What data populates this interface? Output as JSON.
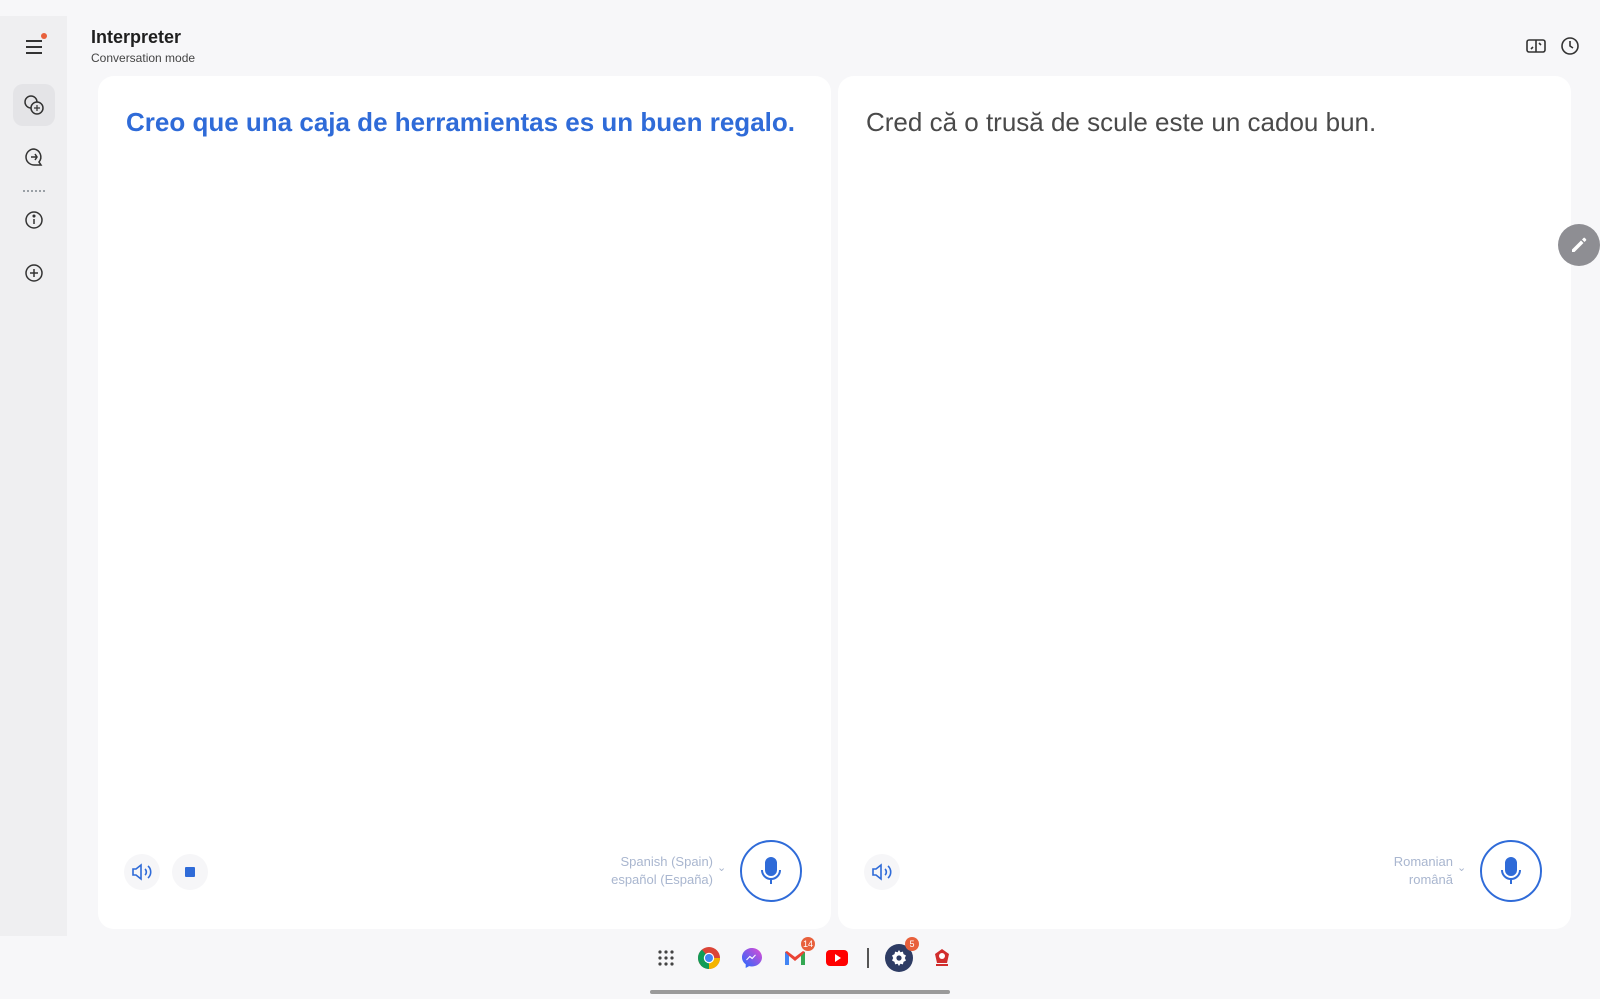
{
  "header": {
    "title": "Interpreter",
    "subtitle": "Conversation mode"
  },
  "sidebar": {
    "items": [
      {
        "name": "menu",
        "icon": "menu-icon"
      },
      {
        "name": "conversation",
        "icon": "conversation-icon",
        "active": true
      },
      {
        "name": "chat",
        "icon": "chat-icon"
      },
      {
        "name": "info",
        "icon": "info-icon"
      },
      {
        "name": "add",
        "icon": "add-circle-icon"
      }
    ]
  },
  "panels": {
    "left": {
      "text": "Creo que una caja de herramientas es un buen regalo.",
      "language_name": "Spanish (Spain)",
      "language_native": "español (España)"
    },
    "right": {
      "text": "Cred că o trusă de scule este un cadou bun.",
      "language_name": "Romanian",
      "language_native": "română"
    }
  },
  "dock": {
    "gmail_badge": "14",
    "settings_badge": "5"
  },
  "colors": {
    "accent": "#2f6bd8",
    "notification": "#e8603c",
    "panel": "#ffffff",
    "background": "#f7f7f9"
  }
}
